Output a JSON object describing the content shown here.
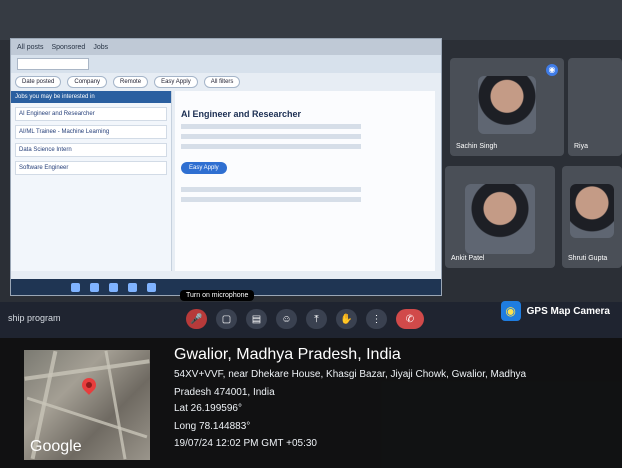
{
  "colors": {
    "accent": "#3f7ce8",
    "danger": "#d14a4a",
    "overlay": "#111111"
  },
  "browser": {
    "tabs": [
      "All posts",
      "Sponsored",
      "Jobs"
    ],
    "filters": [
      "Date posted",
      "Company",
      "Remote",
      "Easy Apply",
      "All filters"
    ]
  },
  "jobs": {
    "header": "Jobs you may be interested in",
    "items": [
      "AI Engineer and Researcher",
      "AI/ML Trainee - Machine Learning",
      "Data Science Intern",
      "Software Engineer"
    ]
  },
  "job_detail": {
    "title": "AI Engineer and Researcher",
    "apply": "Easy Apply"
  },
  "participants": {
    "tiles": [
      {
        "name": "Sachin Singh"
      },
      {
        "name": "Ankit Patel"
      },
      {
        "name": "Shruti Gupta"
      },
      {
        "name": "Riya"
      }
    ]
  },
  "meet": {
    "left_text": "ship program",
    "tooltip": "Turn on microphone"
  },
  "gps": {
    "app_name": "GPS Map Camera",
    "city": "Gwalior, Madhya Pradesh, India",
    "address_line1": "54XV+VVF, near Dhekare House, Khasgi Bazar, Jiyaji Chowk, Gwalior, Madhya",
    "address_line2": "Pradesh 474001, India",
    "lat": "Lat 26.199596°",
    "long": "Long 78.144883°",
    "datetime": "19/07/24 12:02 PM GMT +05:30",
    "google": "Google"
  }
}
